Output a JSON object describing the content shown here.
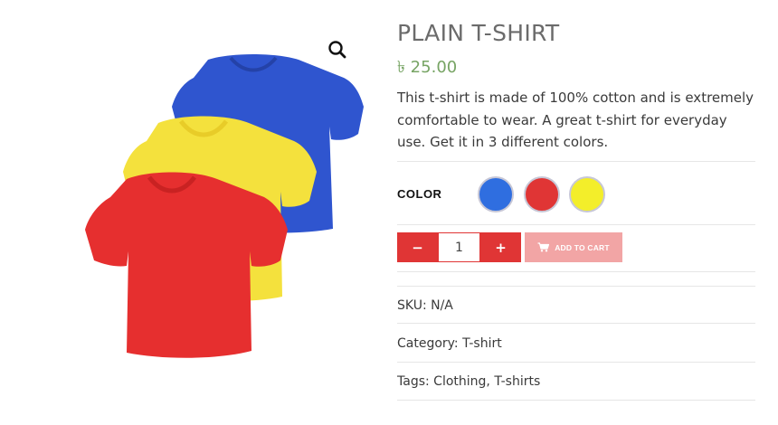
{
  "product": {
    "title": "PLAIN T-SHIRT",
    "price": "৳ 25.00",
    "description": "This t-shirt is made of 100% cotton and is extremely comfortable to wear. A great t-shirt for everyday use. Get it in 3 different colors.",
    "image_icon": "search-icon",
    "image_alt": "Three t-shirts in blue, yellow and red"
  },
  "variations": {
    "color_label": "COLOR",
    "swatches": [
      {
        "name": "blue",
        "color": "#2f6ee0"
      },
      {
        "name": "red",
        "color": "#e03535"
      },
      {
        "name": "yellow",
        "color": "#f3ee2a"
      }
    ]
  },
  "cart": {
    "minus_label": "−",
    "plus_label": "+",
    "quantity": "1",
    "add_to_cart_label": "ADD TO CART",
    "cart_icon": "cart-icon"
  },
  "meta": {
    "sku_label": "SKU:",
    "sku_value": "N/A",
    "category_label": "Category:",
    "category_value": "T-shirt",
    "tags_label": "Tags:",
    "tags": [
      "Clothing",
      "T-shirts"
    ],
    "tags_separator": ","
  },
  "colors": {
    "accent_red": "#e03535",
    "add_to_cart_bg": "#f2a5a5",
    "price_green": "#77a464",
    "title_gray": "#6b6b6b"
  }
}
